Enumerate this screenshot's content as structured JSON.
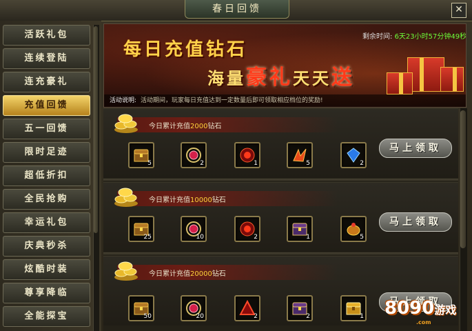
{
  "window": {
    "title": "春日回馈",
    "close_glyph": "✕"
  },
  "sidebar": {
    "items": [
      {
        "label": "活跃礼包"
      },
      {
        "label": "连续登陆"
      },
      {
        "label": "连充豪礼"
      },
      {
        "label": "充值回馈"
      },
      {
        "label": "五一回馈"
      },
      {
        "label": "限时足迹"
      },
      {
        "label": "超低折扣"
      },
      {
        "label": "全民抢购"
      },
      {
        "label": "幸运礼包"
      },
      {
        "label": "庆典秒杀"
      },
      {
        "label": "炫酷时装"
      },
      {
        "label": "尊享降临"
      },
      {
        "label": "全能探宝"
      }
    ],
    "active_index": 3
  },
  "banner": {
    "line1": "每日充值钻石",
    "line2_a": "海量",
    "line2_b": "豪礼",
    "line2_c": "天天",
    "line2_d": "送",
    "timer_label": "剩余时间:",
    "timer_value": "6天23小时57分钟49秒",
    "desc_label": "活动说明:",
    "desc_text": "活动期间，玩家每日充值达到一定数量后即可领取相应档位的奖励!"
  },
  "tiers": [
    {
      "label_prefix": "今日累计充值",
      "amount": "2000",
      "label_suffix": "钻石",
      "rewards": [
        {
          "icon": "treasure-chest-icon",
          "count": "5"
        },
        {
          "icon": "ruby-necklace-icon",
          "count": "2"
        },
        {
          "icon": "red-orb-icon",
          "count": "1"
        },
        {
          "icon": "flame-wings-icon",
          "count": "5"
        },
        {
          "icon": "blue-gem-icon",
          "count": "2"
        }
      ],
      "button": "马上领取"
    },
    {
      "label_prefix": "今日累计充值",
      "amount": "10000",
      "label_suffix": "钻石",
      "rewards": [
        {
          "icon": "treasure-chest-icon",
          "count": "25"
        },
        {
          "icon": "ruby-necklace-icon",
          "count": "10"
        },
        {
          "icon": "red-orb-icon",
          "count": "2"
        },
        {
          "icon": "purple-chest-icon",
          "count": "1"
        },
        {
          "icon": "gold-pot-icon",
          "count": "5"
        }
      ],
      "button": "马上领取"
    },
    {
      "label_prefix": "今日累计充值",
      "amount": "20000",
      "label_suffix": "钻石",
      "rewards": [
        {
          "icon": "treasure-chest-icon",
          "count": "50"
        },
        {
          "icon": "ruby-necklace-icon",
          "count": "20"
        },
        {
          "icon": "red-triangle-icon",
          "count": "2"
        },
        {
          "icon": "purple-chest-icon",
          "count": "2"
        },
        {
          "icon": "golden-chest-icon",
          "count": "1"
        }
      ],
      "button": "马上领取"
    }
  ],
  "watermark": {
    "number": "8090",
    "brand": "游戏",
    "domain": ".com"
  }
}
